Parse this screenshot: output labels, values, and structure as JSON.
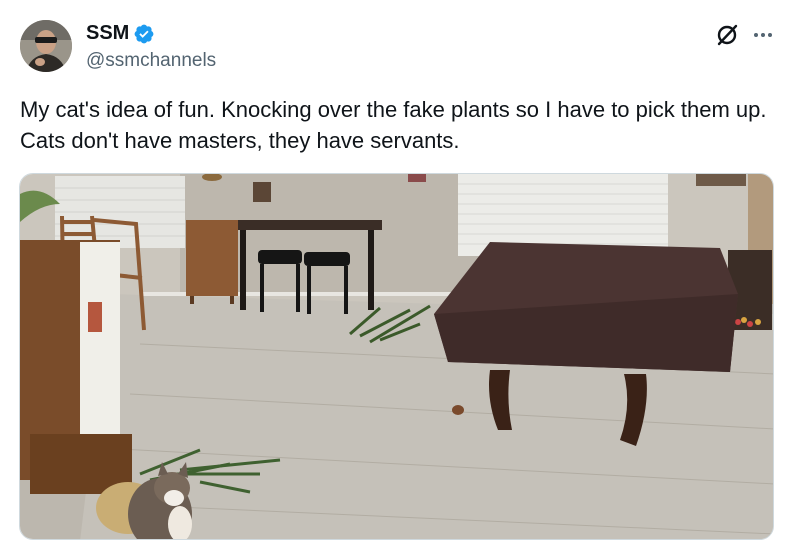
{
  "author": {
    "display_name": "SSM",
    "handle": "@ssmchannels",
    "verified": true,
    "avatar_icon": "profile-photo"
  },
  "actions": {
    "grok_icon": "grok-icon",
    "more_icon": "more-icon"
  },
  "tweet": {
    "text": "My cat's idea of fun. Knocking over the fake plants so I have to pick them up. Cats don't have masters, they have servants."
  },
  "media": {
    "icon": "photo-cat-pool-table-room"
  },
  "colors": {
    "verified_blue": "#1d9bf0",
    "text_primary": "#0f1419",
    "text_secondary": "#536471"
  }
}
